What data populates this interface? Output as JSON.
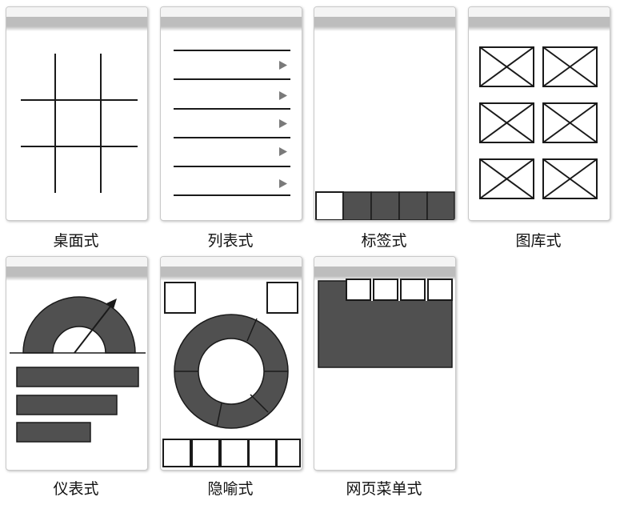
{
  "colors": {
    "fill": "#505050",
    "stroke": "#1a1a1a",
    "bar": "#bdbdbd"
  },
  "labels": {
    "desktop": "桌面式",
    "list": "列表式",
    "tab": "标签式",
    "gallery": "图库式",
    "dashboard": "仪表式",
    "metaphor": "隐喻式",
    "webmenu": "网页菜单式"
  }
}
